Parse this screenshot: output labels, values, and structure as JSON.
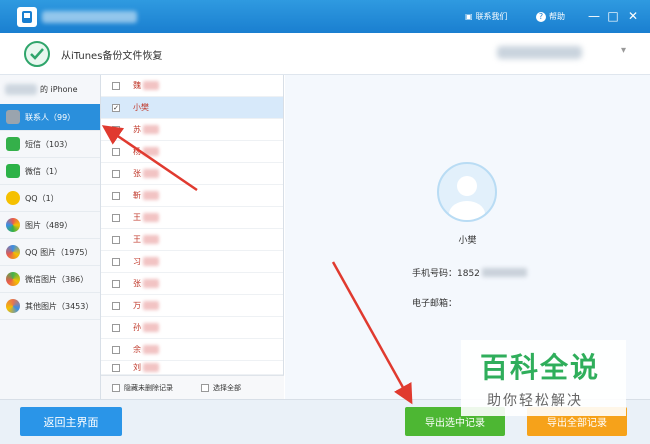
{
  "titlebar": {
    "contact_label": "联系我们",
    "help_label": "帮助",
    "min": "—",
    "max": "□",
    "close": "✕"
  },
  "header": {
    "title": "从iTunes备份文件恢复",
    "chevron": "▾"
  },
  "sidebar": {
    "device_label": "的 iPhone",
    "items": [
      {
        "label": "联系人（99）",
        "color": "#9aa4ae"
      },
      {
        "label": "短信（103）",
        "color": "#34b04a"
      },
      {
        "label": "微信（1）",
        "color": "#2db248"
      },
      {
        "label": "QQ（1）",
        "color": "#f5c000"
      },
      {
        "label": "图片（489）",
        "color": "#e85a4f"
      },
      {
        "label": "QQ 图片（1975）",
        "color": "#3a8ee6"
      },
      {
        "label": "微信图片（386）",
        "color": "#44b24c"
      },
      {
        "label": "其他图片（3453）",
        "color": "#e8744f"
      }
    ]
  },
  "contacts": [
    {
      "name": "魏",
      "checked": false
    },
    {
      "name": "小樊",
      "checked": true
    },
    {
      "name": "苏",
      "checked": false
    },
    {
      "name": "杨",
      "checked": false
    },
    {
      "name": "张",
      "checked": false
    },
    {
      "name": "靳",
      "checked": false
    },
    {
      "name": "王",
      "checked": false
    },
    {
      "name": "王",
      "checked": false
    },
    {
      "name": "习",
      "checked": false
    },
    {
      "name": "张",
      "checked": false
    },
    {
      "name": "万",
      "checked": false
    },
    {
      "name": "孙",
      "checked": false
    },
    {
      "name": "余",
      "checked": false
    },
    {
      "name": "刘",
      "checked": false
    }
  ],
  "list_footer": {
    "hide_deleted": "隐藏未删除记录",
    "select_all": "选择全部"
  },
  "detail": {
    "name": "小樊",
    "phone_label": "手机号码：1852",
    "email_label": "电子邮箱："
  },
  "footer": {
    "back": "返回主界面",
    "export_selected": "导出选中记录",
    "export_all": "导出全部记录"
  },
  "watermark": {
    "line1": "百科全说",
    "line2": "助你轻松解决"
  }
}
